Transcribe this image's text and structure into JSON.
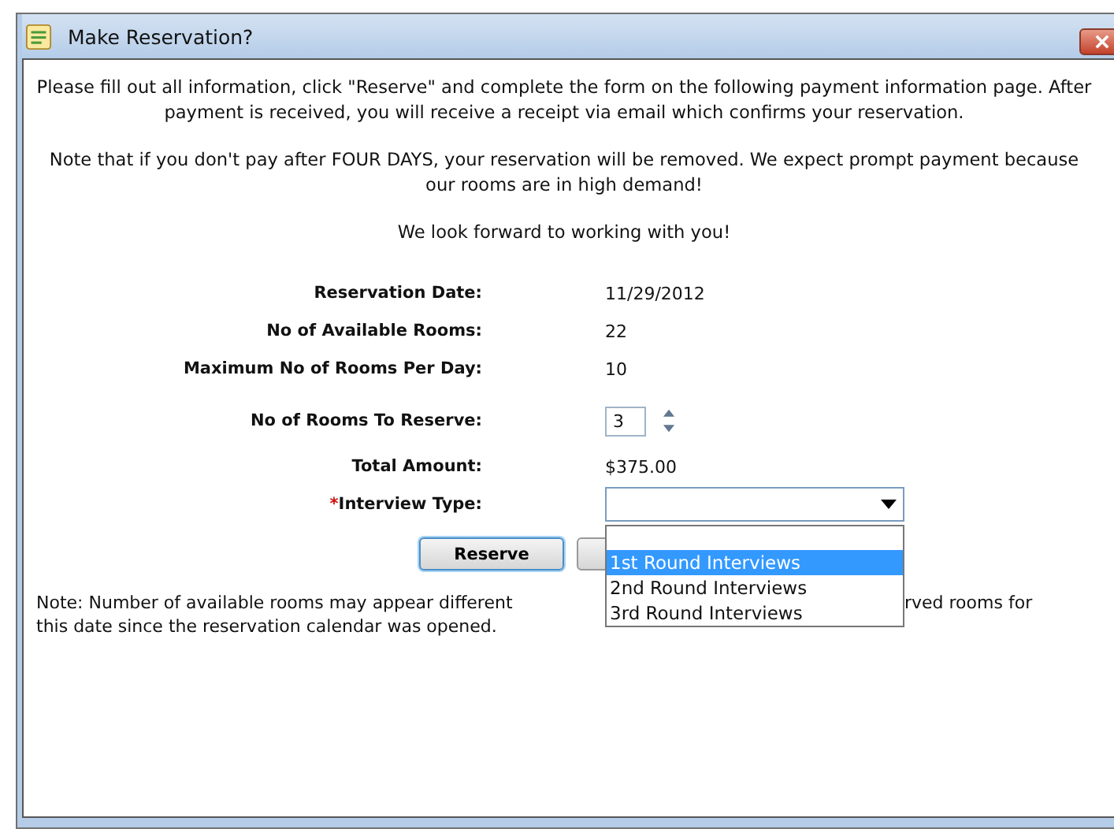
{
  "window": {
    "title": "Make Reservation?"
  },
  "intro": [
    "Please fill out all information, click \"Reserve\" and complete the form on the following payment information page. After payment is received, you will receive a receipt via email which confirms your reservation.",
    "Note that if you don't pay after FOUR DAYS, your reservation will be removed. We expect prompt payment because our rooms are in high demand!",
    "We look forward to working with you!"
  ],
  "fields": [
    {
      "kind": "text",
      "label": "Reservation Date:",
      "value": "11/29/2012"
    },
    {
      "kind": "text",
      "label": "No of Available Rooms:",
      "value": "22"
    },
    {
      "kind": "text",
      "label": "Maximum No of Rooms Per Day:",
      "value": "10"
    },
    {
      "kind": "spinner",
      "label": "No of Rooms To Reserve:",
      "value": "3"
    },
    {
      "kind": "text",
      "label": "Total Amount:",
      "value": "$375.00"
    },
    {
      "kind": "select",
      "required_mark": "*",
      "label": "Interview Type:",
      "expanded": true,
      "options": [
        {
          "label": "1st Round Interviews",
          "selected": true
        },
        {
          "label": "2nd Round Interviews",
          "selected": false
        },
        {
          "label": "3rd Round Interviews",
          "selected": false
        }
      ]
    }
  ],
  "buttons": {
    "reserve": "Reserve"
  },
  "note": {
    "line_1_start": "Note: Number of available rooms may appear different",
    "line_1_end": "rved rooms for",
    "line_2": "this date since the reservation calendar was opened."
  }
}
